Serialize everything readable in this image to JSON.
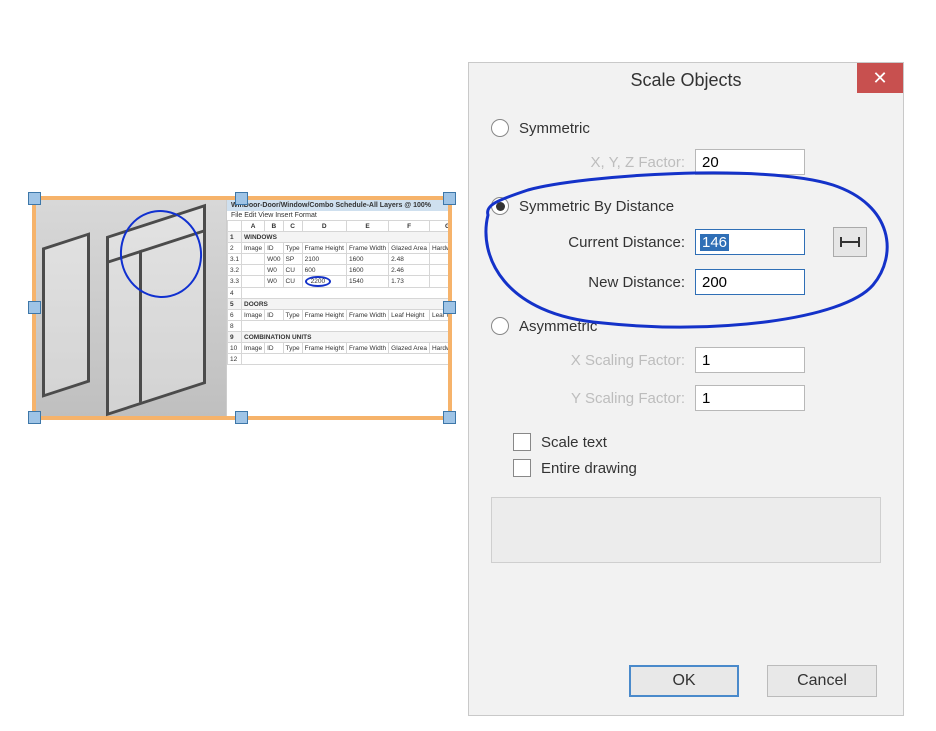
{
  "dialog": {
    "title": "Scale Objects",
    "options": {
      "symmetric_label": "Symmetric",
      "symmetric_by_distance_label": "Symmetric By Distance",
      "asymmetric_label": "Asymmetric",
      "selected": "symmetric_by_distance"
    },
    "fields": {
      "xyz_label": "X, Y, Z Factor:",
      "xyz_value": "20",
      "current_distance_label": "Current Distance:",
      "current_distance_value": "146",
      "new_distance_label": "New Distance:",
      "new_distance_value": "200",
      "x_scale_label": "X Scaling Factor:",
      "x_scale_value": "1",
      "y_scale_label": "Y Scaling Factor:",
      "y_scale_value": "1"
    },
    "checks": {
      "scale_text_label": "Scale text",
      "entire_drawing_label": "Entire drawing"
    },
    "buttons": {
      "ok": "OK",
      "cancel": "Cancel"
    }
  },
  "worksheet": {
    "title": "WinDoor-Door/Window/Combo Schedule-All Layers @ 100%",
    "menu": "File  Edit  View  Insert  Format",
    "columns": [
      "",
      "A",
      "B",
      "C",
      "D",
      "E",
      "F",
      "G"
    ],
    "header_windows": "WINDOWS",
    "header_doors": "DOORS",
    "header_combo": "COMBINATION UNITS",
    "headers": [
      "Image",
      "ID",
      "Type",
      "Frame Height",
      "Frame Width",
      "Glazed Area",
      "Hardware"
    ],
    "headers2": [
      "Image",
      "ID",
      "Type",
      "Frame Height",
      "Frame Width",
      "Leaf Height",
      "Leaf Width"
    ],
    "rows": [
      {
        "n": "3.1",
        "id": "W00",
        "type": "SP",
        "fh": "2100",
        "fw": "1600",
        "ga": "2.48"
      },
      {
        "n": "3.2",
        "id": "W0",
        "type": "CU",
        "fh": "600",
        "fw": "1600",
        "ga": "2.46"
      },
      {
        "n": "3.3",
        "id": "W0",
        "type": "CU",
        "fh": "2200",
        "fw": "1540",
        "ga": "1.73"
      }
    ]
  }
}
